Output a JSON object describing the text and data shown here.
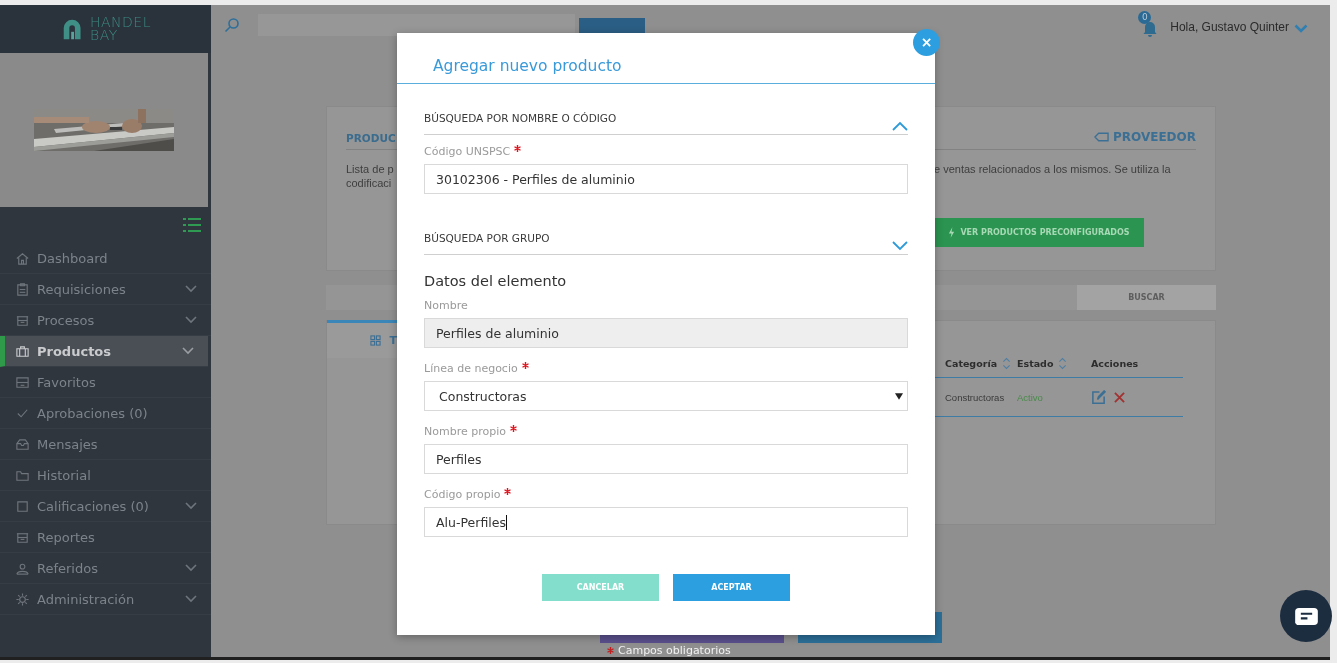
{
  "sidebar": {
    "logo": {
      "line1": "HANDEL",
      "line2": "BAY"
    },
    "items": [
      {
        "label": "Dashboard",
        "expandable": false,
        "selected": false
      },
      {
        "label": "Requisiciones",
        "expandable": true,
        "selected": false
      },
      {
        "label": "Procesos",
        "expandable": true,
        "selected": false
      },
      {
        "label": "Productos",
        "expandable": true,
        "selected": true
      },
      {
        "label": "Favoritos",
        "expandable": false,
        "selected": false
      },
      {
        "label": "Aprobaciones (0)",
        "expandable": false,
        "selected": false
      },
      {
        "label": "Mensajes",
        "expandable": false,
        "selected": false
      },
      {
        "label": "Historial",
        "expandable": false,
        "selected": false
      },
      {
        "label": "Calificaciones (0)",
        "expandable": true,
        "selected": false
      },
      {
        "label": "Reportes",
        "expandable": false,
        "selected": false
      },
      {
        "label": "Referidos",
        "expandable": true,
        "selected": false
      },
      {
        "label": "Administración",
        "expandable": true,
        "selected": false
      }
    ]
  },
  "header": {
    "notifications": "0",
    "greeting": "Hola, Gustavo Quinter"
  },
  "card": {
    "title": "PRODUC",
    "link": "PROVEEDOR",
    "description_left": [
      "Lista de p",
      "codificaci"
    ],
    "description_right": "e ventas relacionados a los mismos. Se utiliza la",
    "action": "VER PRODUCTOS PRECONFIGURADOS"
  },
  "search": {
    "button": "BUSCAR"
  },
  "table": {
    "tab": "T",
    "columns": [
      {
        "label": "Categoría",
        "sortable": true
      },
      {
        "label": "Estado",
        "sortable": true
      },
      {
        "label": "Acciones",
        "sortable": false
      }
    ],
    "rows": [
      {
        "category": "Constructoras",
        "status": "Activo"
      }
    ]
  },
  "footer_note": "Campos obligatorios",
  "modal": {
    "title": "Agregar nuevo producto",
    "close": "×",
    "blocks": [
      {
        "kind": "section",
        "label": "BÚSQUEDA POR NOMBRE O CÓDIGO",
        "expanded": true
      },
      {
        "kind": "text",
        "label": "Código UNSPSC",
        "required": true,
        "value": "30102306 - Perfiles de aluminio",
        "focused": false
      },
      {
        "kind": "section",
        "label": "BÚSQUEDA POR GRUPO",
        "expanded": false
      },
      {
        "kind": "heading",
        "label": "Datos del elemento"
      },
      {
        "kind": "readonly",
        "label": "Nombre",
        "required": false,
        "value": "Perfiles de aluminio"
      },
      {
        "kind": "select",
        "label": "Línea de negocio",
        "required": true,
        "value": "Constructoras"
      },
      {
        "kind": "text",
        "label": "Nombre propio",
        "required": true,
        "value": "Perfiles",
        "focused": false
      },
      {
        "kind": "text",
        "label": "Código propio",
        "required": true,
        "value": "Alu-Perfiles",
        "focused": true
      }
    ],
    "buttons": [
      {
        "label": "CANCELAR",
        "kind": "secondary"
      },
      {
        "label": "ACEPTAR",
        "kind": "primary"
      }
    ]
  }
}
